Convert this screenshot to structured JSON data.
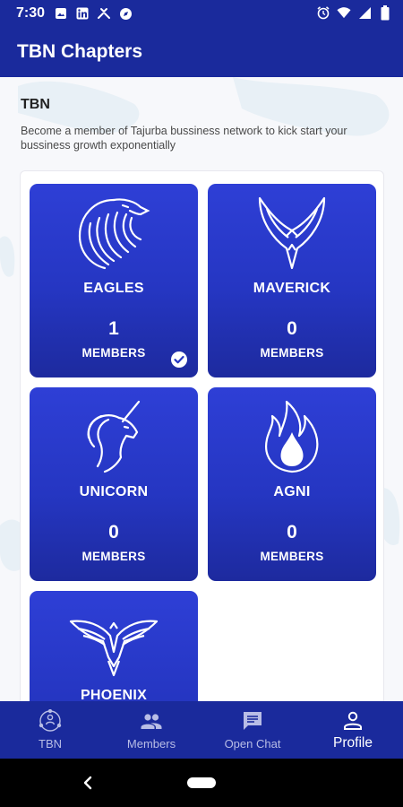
{
  "status_bar": {
    "time": "7:30",
    "left_icons": [
      "image-icon",
      "linkedin-icon",
      "tools-icon",
      "compass-icon"
    ],
    "right_icons": [
      "alarm-icon",
      "wifi-icon",
      "signal-icon",
      "battery-icon"
    ]
  },
  "app_bar": {
    "title": "TBN Chapters"
  },
  "section": {
    "title": "TBN",
    "description": "Become a member of Tajurba bussiness network to kick start your bussiness growth exponentially"
  },
  "chapters": [
    {
      "name": "EAGLES",
      "count": "1",
      "members_label": "MEMBERS",
      "icon": "eagle-icon",
      "joined": true
    },
    {
      "name": "MAVERICK",
      "count": "0",
      "members_label": "MEMBERS",
      "icon": "maverick-bird-icon",
      "joined": false
    },
    {
      "name": "UNICORN",
      "count": "0",
      "members_label": "MEMBERS",
      "icon": "unicorn-icon",
      "joined": false
    },
    {
      "name": "AGNI",
      "count": "0",
      "members_label": "MEMBERS",
      "icon": "flame-icon",
      "joined": false
    },
    {
      "name": "PHOENIX",
      "count": "",
      "members_label": "",
      "icon": "phoenix-icon",
      "joined": false
    }
  ],
  "bottom_nav": {
    "active": "Profile",
    "items": [
      {
        "label": "TBN",
        "icon": "network-icon"
      },
      {
        "label": "Members",
        "icon": "group-icon"
      },
      {
        "label": "Open Chat",
        "icon": "chat-icon"
      },
      {
        "label": "Profile",
        "icon": "person-icon"
      }
    ]
  },
  "colors": {
    "primary": "#1a2a9c",
    "tile_top": "#2e3fd6",
    "tile_bottom": "#1d2a9e",
    "nav_inactive": "#b8bde6"
  }
}
